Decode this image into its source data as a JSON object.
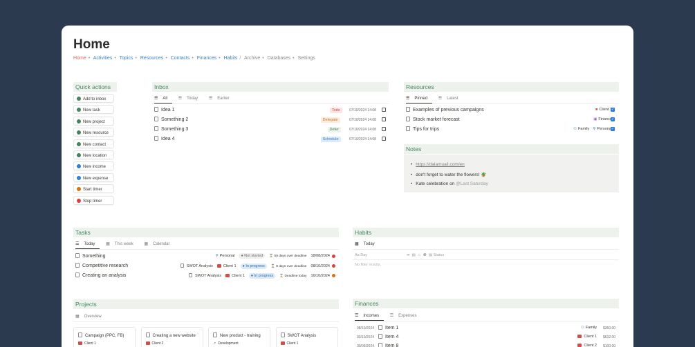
{
  "page": {
    "title": "Home"
  },
  "breadcrumb": {
    "home": "Home",
    "activities": "Activities",
    "topics": "Topics",
    "resources": "Resources",
    "contacts": "Contacts",
    "finances": "Finances",
    "habits": "Habits",
    "archive": "Archive",
    "databases": "Databases",
    "settings": "Settings"
  },
  "quick_actions": {
    "title": "Quick actions",
    "buttons": [
      {
        "label": "Add to inbox",
        "color": "#448361"
      },
      {
        "label": "New task",
        "color": "#448361"
      },
      {
        "label": "New project",
        "color": "#448361"
      },
      {
        "label": "New resource",
        "color": "#448361"
      },
      {
        "label": "New contact",
        "color": "#448361"
      },
      {
        "label": "New location",
        "color": "#448361"
      },
      {
        "label": "New income",
        "color": "#2e7ed6"
      },
      {
        "label": "New expense",
        "color": "#2e7ed6"
      },
      {
        "label": "Start timer",
        "color": "#d9730d"
      },
      {
        "label": "Stop timer",
        "color": "#e03e3e"
      }
    ]
  },
  "inbox": {
    "title": "Inbox",
    "tabs": [
      "All",
      "Today",
      "Earlier"
    ],
    "rows": [
      {
        "name": "Idea 1",
        "tag": "Todo",
        "date": "07/10/2024 14:08"
      },
      {
        "name": "Something 2",
        "tag": "Delegate",
        "date": "07/10/2024 14:08"
      },
      {
        "name": "Something 3",
        "tag": "Defer",
        "date": "07/10/2024 14:08"
      },
      {
        "name": "Idea 4",
        "tag": "Schedule",
        "date": "07/10/2024 14:08"
      }
    ]
  },
  "resources": {
    "title": "Resources",
    "tabs": [
      "Pinned",
      "Latest"
    ],
    "rows": [
      {
        "name": "Examples of previous campaigns",
        "tags": [
          "Client 1"
        ]
      },
      {
        "name": "Stock market forecast",
        "tags": [
          "Finance"
        ]
      },
      {
        "name": "Tips for trips",
        "tags": [
          "Family",
          "Personal"
        ]
      }
    ]
  },
  "notes": {
    "title": "Notes",
    "items": [
      "https://dalamuali.com/en",
      "don't forget to water the flowers! 🪴",
      "Kate celebration on",
      "@Last Saturday"
    ]
  },
  "tasks": {
    "title": "Tasks",
    "tabs": [
      "Today",
      "This week",
      "Calendar"
    ],
    "rows": [
      {
        "name": "Something",
        "topic": "",
        "client": "",
        "area": "Personal",
        "status": "Not started",
        "deadline": "59 days over deadline",
        "date": "18/08/2024",
        "dot": "#e03e3e"
      },
      {
        "name": "Competitive research",
        "topic": "SWOT Analysis",
        "client": "Client 1",
        "area": "",
        "status": "In progress",
        "deadline": "8 days over deadline",
        "date": "08/10/2024",
        "dot": "#e03e3e"
      },
      {
        "name": "Creating an analysis",
        "topic": "SWOT Analysis",
        "client": "Client 1",
        "area": "",
        "status": "In progress",
        "deadline": "Deadline today",
        "date": "16/10/2024",
        "dot": "#d9730d"
      }
    ]
  },
  "habits": {
    "title": "Habits",
    "tab": "Today",
    "columns": [
      "Day",
      "Status"
    ],
    "empty": "No filter results."
  },
  "projects": {
    "title": "Projects",
    "tab": "Overview",
    "cards": [
      {
        "name": "Campaign (PPC, FB)",
        "sub": "Client 1"
      },
      {
        "name": "Creating a new website",
        "sub": "Client 2"
      },
      {
        "name": "New product - training",
        "sub": "Development"
      },
      {
        "name": "SWOT Analysis",
        "sub": "Client 1"
      }
    ]
  },
  "finances": {
    "title": "Finances",
    "tabs": [
      "Incomes",
      "Expenses"
    ],
    "rows": [
      {
        "date": "08/10/2024",
        "name": "Item 1",
        "tag": "Family",
        "amount": "$350.00"
      },
      {
        "date": "03/10/2024",
        "name": "Item 4",
        "tag": "Client 1",
        "amount": "$632.00"
      },
      {
        "date": "30/09/2024",
        "name": "Item 8",
        "tag": "Client 2",
        "amount": "$100.00"
      }
    ]
  }
}
